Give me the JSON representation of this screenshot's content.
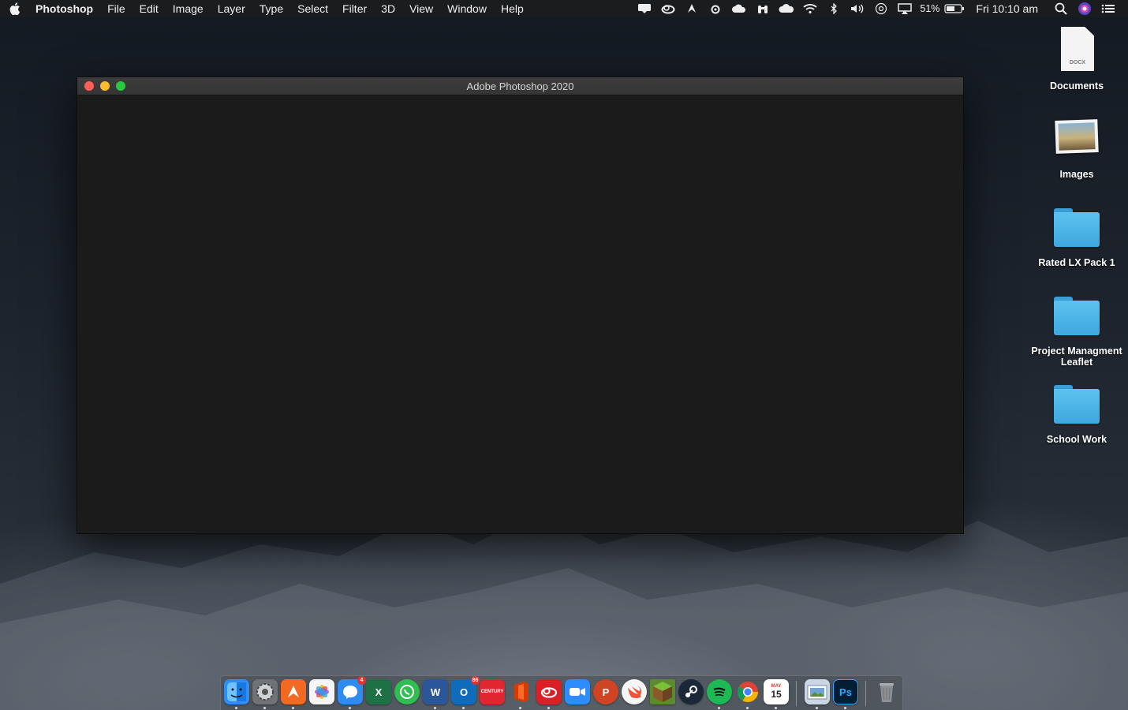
{
  "menubar": {
    "app_name": "Photoshop",
    "menus": [
      "File",
      "Edit",
      "Image",
      "Layer",
      "Type",
      "Select",
      "Filter",
      "3D",
      "View",
      "Window",
      "Help"
    ],
    "battery_percent": "51%",
    "clock": "Fri 10:10 am"
  },
  "window": {
    "title": "Adobe Photoshop 2020"
  },
  "desktop": {
    "items": [
      {
        "label": "Documents",
        "kind": "document",
        "ext": "DOCX"
      },
      {
        "label": "Images",
        "kind": "image"
      },
      {
        "label": "Rated LX Pack 1",
        "kind": "folder"
      },
      {
        "label": "Project Managment Leaflet",
        "kind": "folder"
      },
      {
        "label": "School Work",
        "kind": "folder"
      }
    ]
  },
  "dock": {
    "apps": [
      {
        "name": "finder-icon",
        "color": "#2f8ef3"
      },
      {
        "name": "system-preferences-icon",
        "color": "#6f7378"
      },
      {
        "name": "avast-icon",
        "color": "#f26a22"
      },
      {
        "name": "photos-icon",
        "color": "#f5f5f5"
      },
      {
        "name": "messenger-icon",
        "color": "#2f8bf1",
        "badge": "4"
      },
      {
        "name": "excel-icon",
        "color": "#1e7145",
        "letter": "X"
      },
      {
        "name": "whatsapp-icon",
        "color": "#2fbe50"
      },
      {
        "name": "word-icon",
        "color": "#2b579a",
        "letter": "W"
      },
      {
        "name": "outlook-icon",
        "color": "#0f6cbd",
        "letter": "O",
        "badge": "86"
      },
      {
        "name": "century-icon",
        "color": "#e2262f",
        "letter": "CENTURY"
      },
      {
        "name": "office-icon",
        "color": "#d83b01"
      },
      {
        "name": "creative-cloud-icon",
        "color": "#da1f26"
      },
      {
        "name": "zoom-icon",
        "color": "#2d8cff"
      },
      {
        "name": "powerpoint-icon",
        "color": "#d04423",
        "letter": "P"
      },
      {
        "name": "swift-icon",
        "color": "#f05138"
      },
      {
        "name": "minecraft-icon",
        "color": "#5b8a2f"
      },
      {
        "name": "steam-icon",
        "color": "#1b2838"
      },
      {
        "name": "spotify-icon",
        "color": "#1db954"
      },
      {
        "name": "chrome-icon",
        "color": "#f2f2f2"
      },
      {
        "name": "calendar-icon",
        "color": "#ffffff",
        "letter": "15",
        "month": "MAY"
      },
      {
        "name": "preview-icon",
        "color": "#c9d6e6"
      },
      {
        "name": "photoshop-icon",
        "color": "#001e36",
        "letter": "Ps"
      },
      {
        "name": "trash-icon",
        "color": "#8d9196"
      }
    ]
  }
}
